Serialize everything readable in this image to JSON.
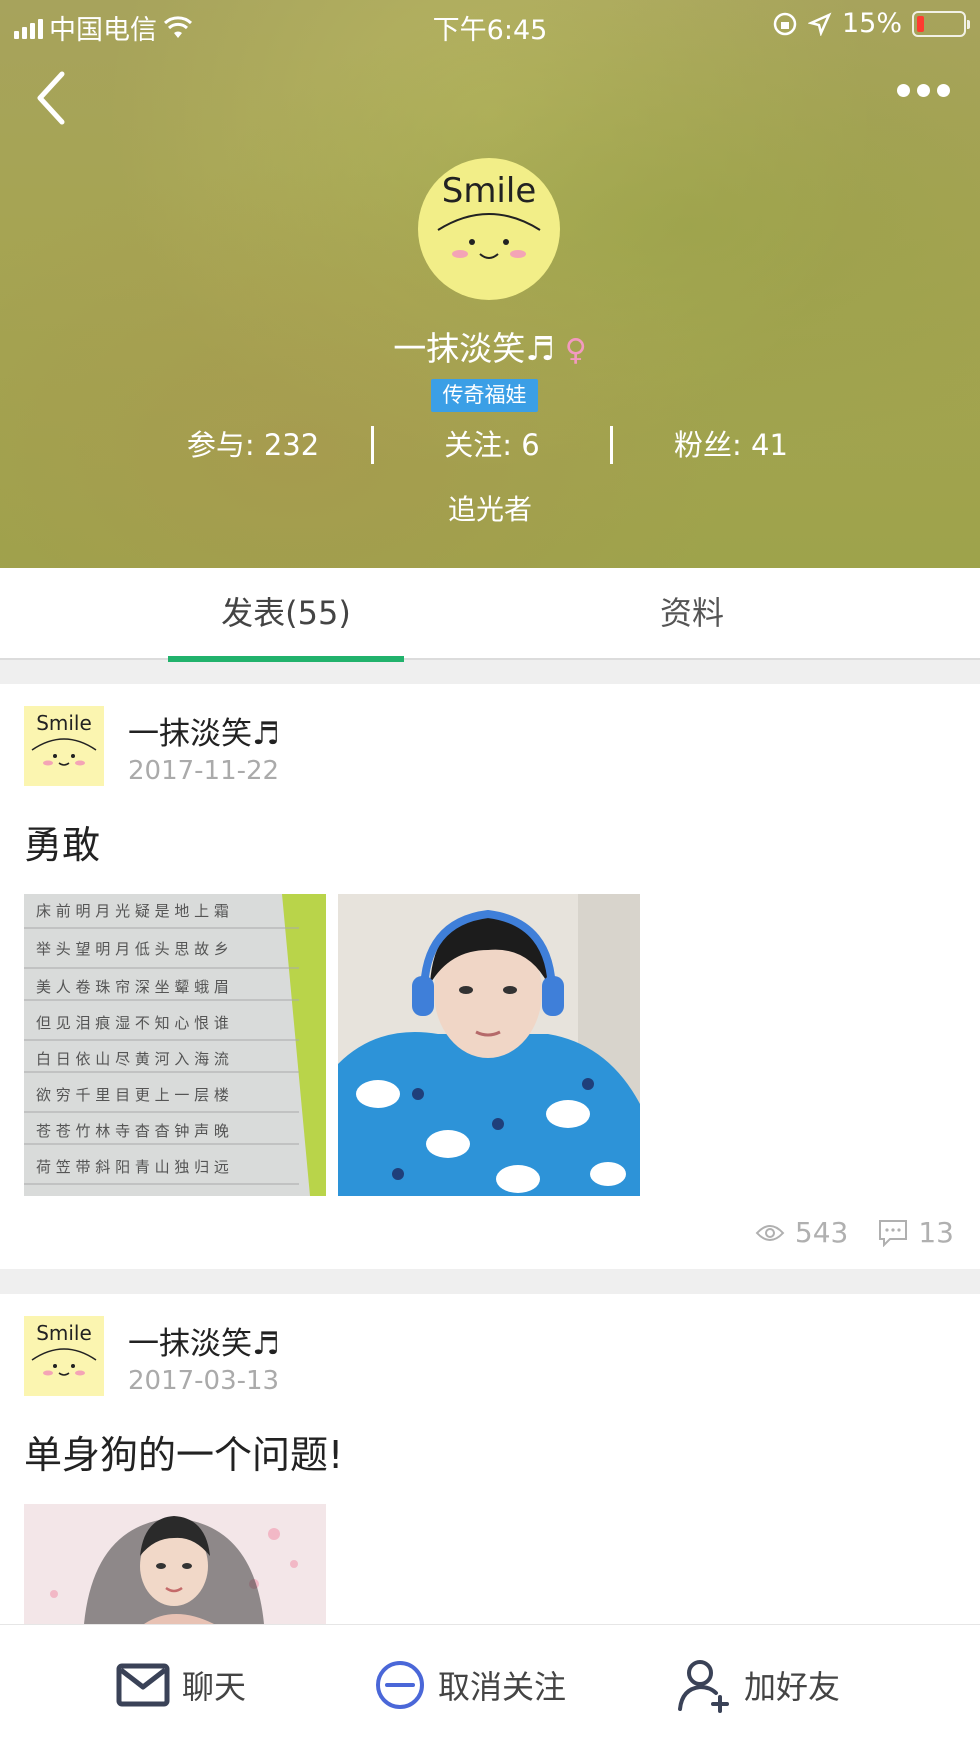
{
  "status_bar": {
    "carrier": "中国电信",
    "time": "下午6:45",
    "battery_percent": "15%",
    "battery_level": 0.15
  },
  "profile": {
    "name": "一抹淡笑♬",
    "badge": "传奇福娃",
    "stats": [
      {
        "label": "参与: 232"
      },
      {
        "label": "关注: 6"
      },
      {
        "label": "粉丝: 41"
      }
    ],
    "signature": "追光者"
  },
  "tabs": [
    {
      "label": "发表(55)",
      "active": true
    },
    {
      "label": "资料",
      "active": false
    }
  ],
  "posts": [
    {
      "author": "一抹淡笑♬",
      "date": "2017-11-22",
      "title": "勇敢",
      "views": "543",
      "comments": "13"
    },
    {
      "author": "一抹淡笑♬",
      "date": "2017-03-13",
      "title": "单身狗的一个问题!"
    }
  ],
  "bottom_bar": {
    "chat": "聊天",
    "unfollow": "取消关注",
    "add_friend": "加好友"
  },
  "colors": {
    "accent_green": "#21b26c",
    "badge_blue": "#3b9fe6",
    "unfollow_blue": "#4a67d8",
    "icon_gray": "#3a4257"
  },
  "icons": [
    "back-arrow-icon",
    "more-icon",
    "female-icon",
    "eye-icon",
    "comment-icon",
    "mail-icon",
    "minus-circle-icon",
    "add-person-icon"
  ]
}
